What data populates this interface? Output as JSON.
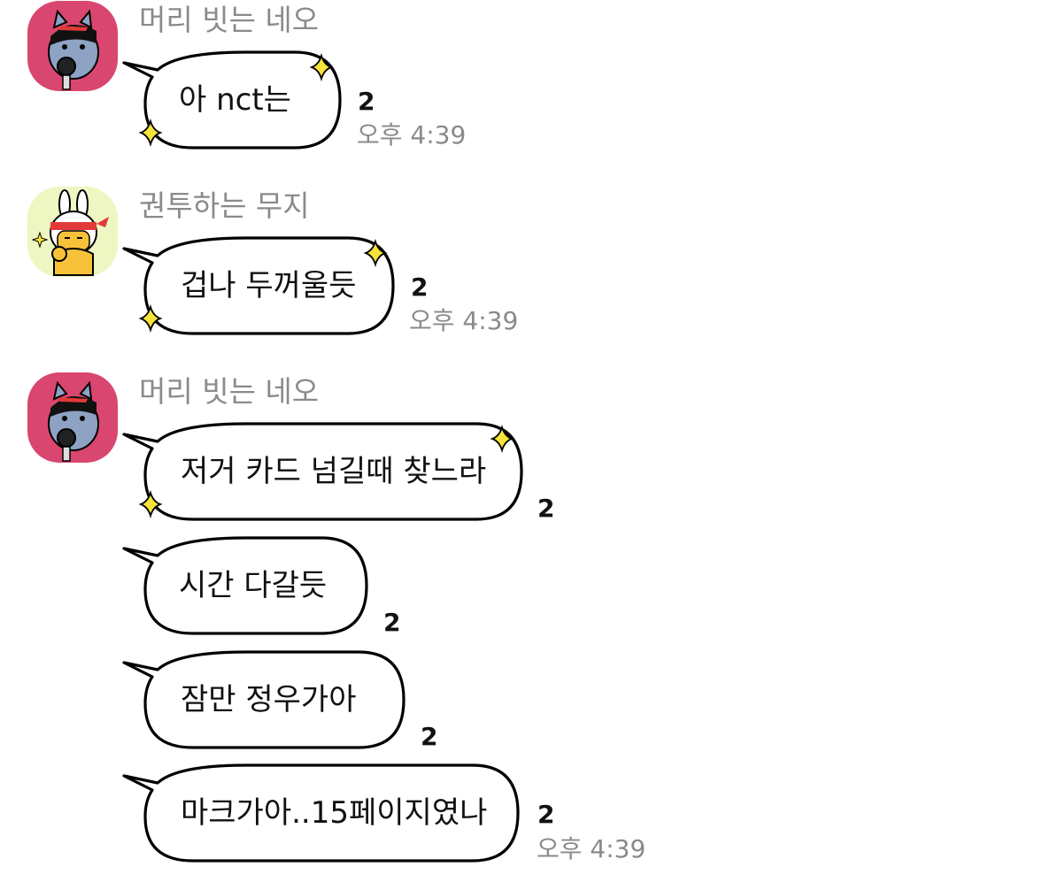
{
  "colors": {
    "avatar_neo_bg": "#d9466f",
    "avatar_muzi_bg": "#eef6c2",
    "sparkle": "#f5e33a",
    "sender_text": "#8a8a8a",
    "bubble_border": "#000000"
  },
  "messages": [
    {
      "sender": "머리 빗는 네오",
      "avatar_icon": "neo-cat-emoticon-icon",
      "text": "아 nct는",
      "unread": "2",
      "time": "오후 4:39"
    },
    {
      "sender": "권투하는 무지",
      "avatar_icon": "muzi-rabbit-emoticon-icon",
      "text": "겁나 두꺼울듯",
      "unread": "2",
      "time": "오후 4:39"
    },
    {
      "sender": "머리 빗는 네오",
      "avatar_icon": "neo-cat-emoticon-icon",
      "text": "저거 카드 넘길때 찾느라",
      "unread": "2",
      "time": ""
    },
    {
      "text": "시간 다갈듯",
      "unread": "2",
      "time": ""
    },
    {
      "text": "잠만 정우가아",
      "unread": "2",
      "time": ""
    },
    {
      "text": "마크가아..15페이지였나",
      "unread": "2",
      "time": "오후 4:39"
    }
  ]
}
